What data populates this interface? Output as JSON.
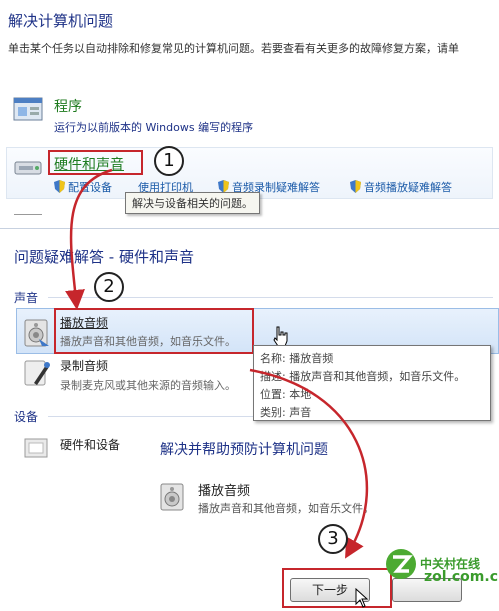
{
  "panel1": {
    "title": "解决计算机问题",
    "description": "单击某个任务以自动排除和修复常见的计算机问题。若要查看有关更多的故障修复方案，请单",
    "categories": [
      {
        "title": "程序",
        "subtitle": "运行为以前版本的 Windows 编写的程序",
        "icon": "programs-icon"
      },
      {
        "title": "硬件和声音",
        "links": [
          "配置设备",
          "使用打印机",
          "音频录制疑难解答",
          "音频播放疑难解答"
        ],
        "icon": "hardware-sound-icon"
      }
    ],
    "tooltip": "解决与设备相关的问题。"
  },
  "panel2": {
    "title": "问题疑难解答 - 硬件和声音",
    "sections": [
      {
        "label": "声音",
        "items": [
          {
            "title": "播放音频",
            "desc": "播放声音和其他音频，如音乐文件。",
            "icon": "speaker-icon"
          },
          {
            "title": "录制音频",
            "desc": "录制麦克风或其他来源的音频输入。",
            "icon": "microphone-icon"
          }
        ]
      },
      {
        "label": "设备",
        "items": [
          {
            "title": "硬件和设备",
            "icon": "device-icon"
          }
        ]
      }
    ],
    "info_popup": {
      "name": "名称: 播放音频",
      "desc": "描述: 播放声音和其他音频，如音乐文件。",
      "location": "位置: 本地",
      "category": "类别: 声音"
    }
  },
  "wizard": {
    "title": "解决并帮助预防计算机问题",
    "item_title": "播放音频",
    "item_desc": "播放声音和其他音频，如音乐文件。",
    "next_label": "下一步"
  },
  "steps": [
    "1",
    "2",
    "3"
  ],
  "watermark": {
    "line1": "中关村在线",
    "line2": "zol.com.cn"
  },
  "colors": {
    "heading_blue": "#1e3287",
    "category_green": "#1e7a1e",
    "link_blue": "#1a5aa8",
    "annotation_red": "#c6262c",
    "selection_blue": "#d3e4f8"
  }
}
